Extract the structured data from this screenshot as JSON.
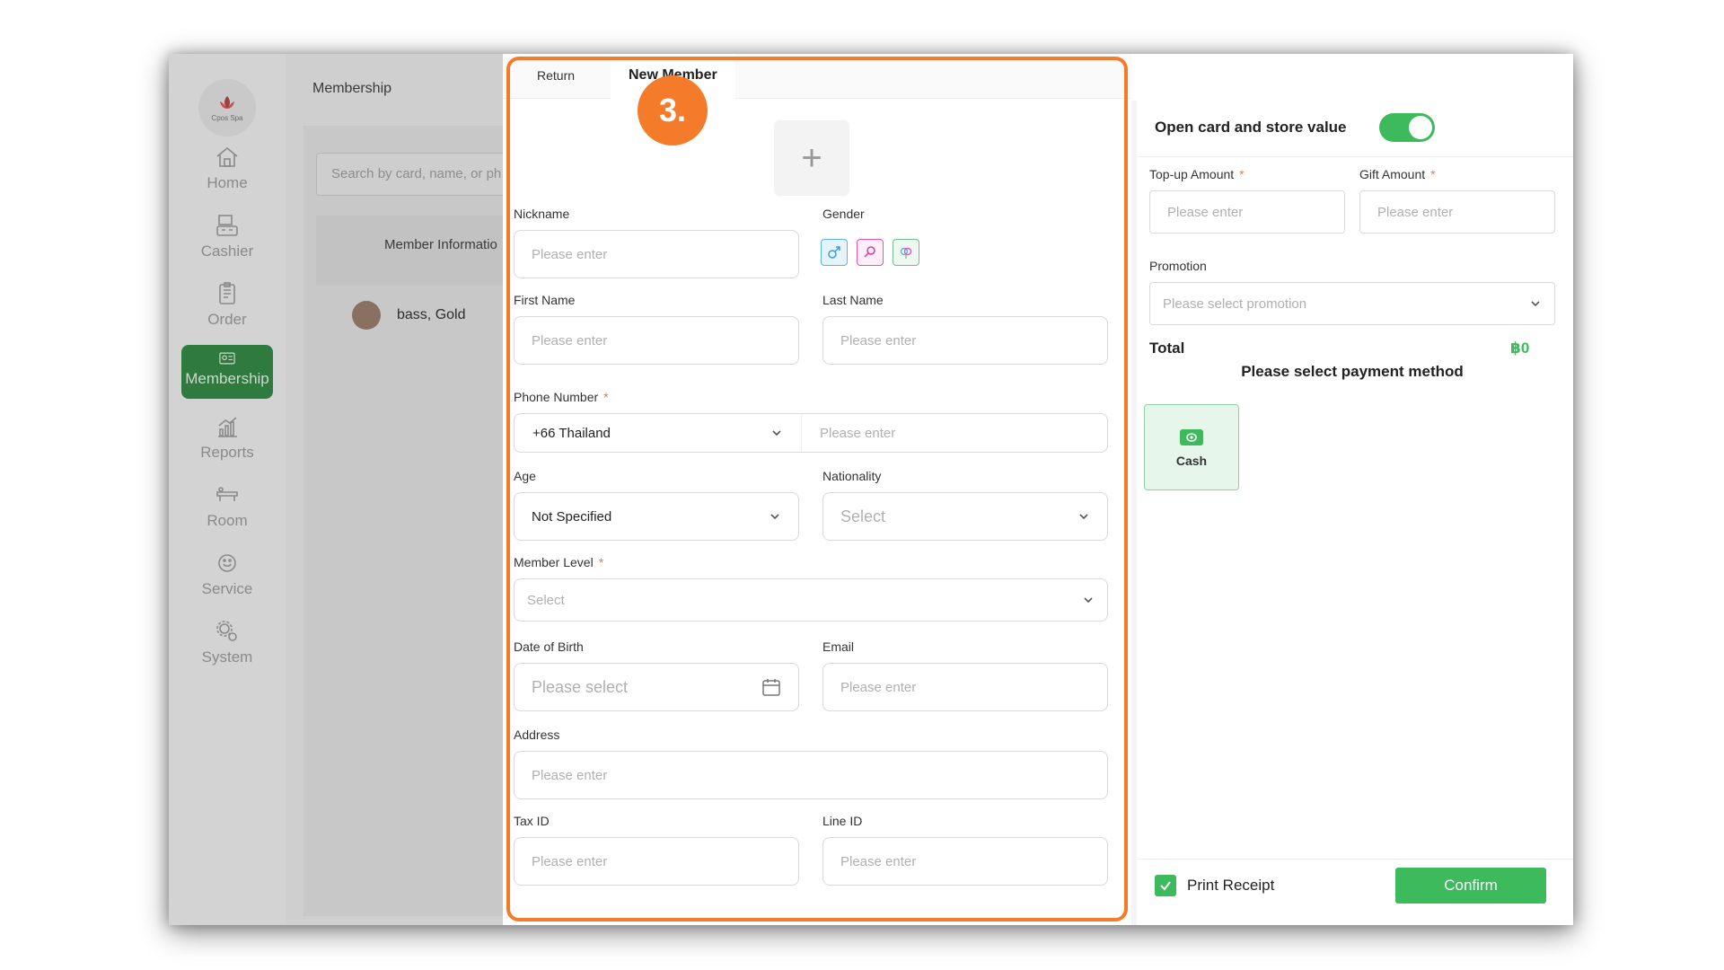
{
  "step_badge": "3.",
  "app": {
    "logo_text": "Cpos Spa",
    "header_title": "Membership",
    "search_placeholder": "Search by card, name, or ph",
    "member_info_header": "Member Informatio",
    "member_row": "bass, Gold"
  },
  "sidebar": {
    "items": [
      {
        "label": "Home",
        "icon": "home-icon"
      },
      {
        "label": "Cashier",
        "icon": "cashier-icon"
      },
      {
        "label": "Order",
        "icon": "order-icon"
      },
      {
        "label": "Membership",
        "icon": "membership-icon",
        "active": true
      },
      {
        "label": "Reports",
        "icon": "reports-icon"
      },
      {
        "label": "Room",
        "icon": "room-icon"
      },
      {
        "label": "Service",
        "icon": "service-icon"
      },
      {
        "label": "System",
        "icon": "system-icon"
      }
    ]
  },
  "form": {
    "tab_return": "Return",
    "tab_new": "New Member",
    "avatar_add": "+",
    "nickname_label": "Nickname",
    "gender_label": "Gender",
    "first_name_label": "First Name",
    "last_name_label": "Last Name",
    "phone_label": "Phone Number",
    "phone_country": "+66 Thailand",
    "age_label": "Age",
    "age_value": "Not Specified",
    "nationality_label": "Nationality",
    "nationality_value": "Select",
    "member_level_label": "Member Level",
    "member_level_value": "Select",
    "dob_label": "Date of Birth",
    "dob_placeholder": "Please select",
    "email_label": "Email",
    "address_label": "Address",
    "tax_id_label": "Tax ID",
    "line_id_label": "Line ID",
    "placeholder": "Please enter",
    "required_mark": "*"
  },
  "right": {
    "open_card_title": "Open card and store value",
    "toggle_on": true,
    "topup_label": "Top-up Amount",
    "gift_label": "Gift Amount",
    "placeholder": "Please enter",
    "promotion_label": "Promotion",
    "promotion_placeholder": "Please select promotion",
    "total_label": "Total",
    "total_value": "฿0",
    "payment_msg": "Please select payment method",
    "cash_label": "Cash",
    "print_receipt_label": "Print Receipt",
    "print_receipt_checked": true,
    "confirm_label": "Confirm",
    "required_mark": "*"
  },
  "colors": {
    "accent_green": "#3cba5c",
    "highlight_orange": "#f47b2a"
  }
}
